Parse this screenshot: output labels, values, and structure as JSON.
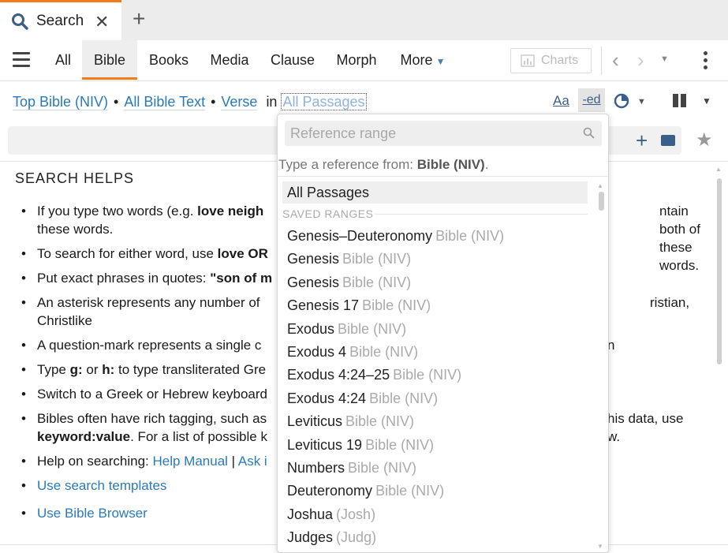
{
  "tab": {
    "label": "Search"
  },
  "toolbar": {
    "nav": [
      "All",
      "Bible",
      "Books",
      "Media",
      "Clause",
      "Morph",
      "More"
    ],
    "charts_label": "Charts"
  },
  "spec": {
    "bible": "Top Bible (NIV)",
    "text": "All Bible Text",
    "unit": "Verse",
    "in_word": "in",
    "range": "All Passages",
    "aa_label": "Aa",
    "ed_label": "-ed"
  },
  "helps": {
    "title": "SEARCH HELPS",
    "items": [
      {
        "pre": "If you type two words (e.g. ",
        "bold": "love neigh",
        "post": "",
        "tail": "ntain both of these words."
      },
      {
        "pre": "To search for either word, use ",
        "bold": "love OR",
        "post": "",
        "tail": ""
      },
      {
        "pre": "Put exact phrases in quotes: ",
        "bold": "\"son of m",
        "post": "",
        "tail": ""
      },
      {
        "pre": "An asterisk represents any number of",
        "bold": "",
        "post": "",
        "tail": "ristian, Christlike"
      },
      {
        "pre": "A question-mark represents a single c",
        "bold": "",
        "post": "",
        "tail": "n"
      },
      {
        "pre": "Type ",
        "bold": "g:",
        "post": " or ",
        "bold2": "h:",
        "post2": " to type transliterated Gre",
        "tail": ""
      },
      {
        "pre": "Switch to a Greek or Hebrew keyboard",
        "bold": "",
        "post": "",
        "tail": ""
      },
      {
        "pre": "Bibles often have rich tagging, such as",
        "bold": "",
        "post": "",
        "tail": "his data, use"
      },
      {
        "pre": "Help on searching: ",
        "link1": "Help Manual",
        "sep": " | ",
        "link2": "Ask i"
      },
      {
        "link": "Use search templates"
      },
      {
        "link": "Use Bible Browser"
      }
    ],
    "line8b_bold": "keyword:value",
    "line8b_rest": ". For a list of possible k",
    "line8b_tail": "w."
  },
  "popup": {
    "placeholder": "Reference range",
    "hint_pre": "Type a reference from: ",
    "hint_bold": "Bible (NIV)",
    "hint_post": ".",
    "all_label": "All Passages",
    "saved_header": "SAVED RANGES",
    "ranges": [
      {
        "name": "Genesis–Deuteronomy",
        "source": "Bible (NIV)"
      },
      {
        "name": "Genesis",
        "source": "Bible (NIV)"
      },
      {
        "name": "Genesis",
        "source": "Bible (NIV)"
      },
      {
        "name": "Genesis 17",
        "source": "Bible (NIV)"
      },
      {
        "name": "Exodus",
        "source": "Bible (NIV)"
      },
      {
        "name": "Exodus 4",
        "source": "Bible (NIV)"
      },
      {
        "name": "Exodus 4:24–25",
        "source": "Bible (NIV)"
      },
      {
        "name": "Exodus 4:24",
        "source": "Bible (NIV)"
      },
      {
        "name": "Leviticus",
        "source": "Bible (NIV)"
      },
      {
        "name": "Leviticus 19",
        "source": "Bible (NIV)"
      },
      {
        "name": "Numbers",
        "source": "Bible (NIV)"
      },
      {
        "name": "Deuteronomy",
        "source": "Bible (NIV)"
      },
      {
        "name": "Joshua",
        "source": "(Josh)"
      },
      {
        "name": "Judges",
        "source": "(Judg)"
      }
    ]
  },
  "colors": {
    "accent": "#f07c1e",
    "link": "#2a7ab8"
  }
}
